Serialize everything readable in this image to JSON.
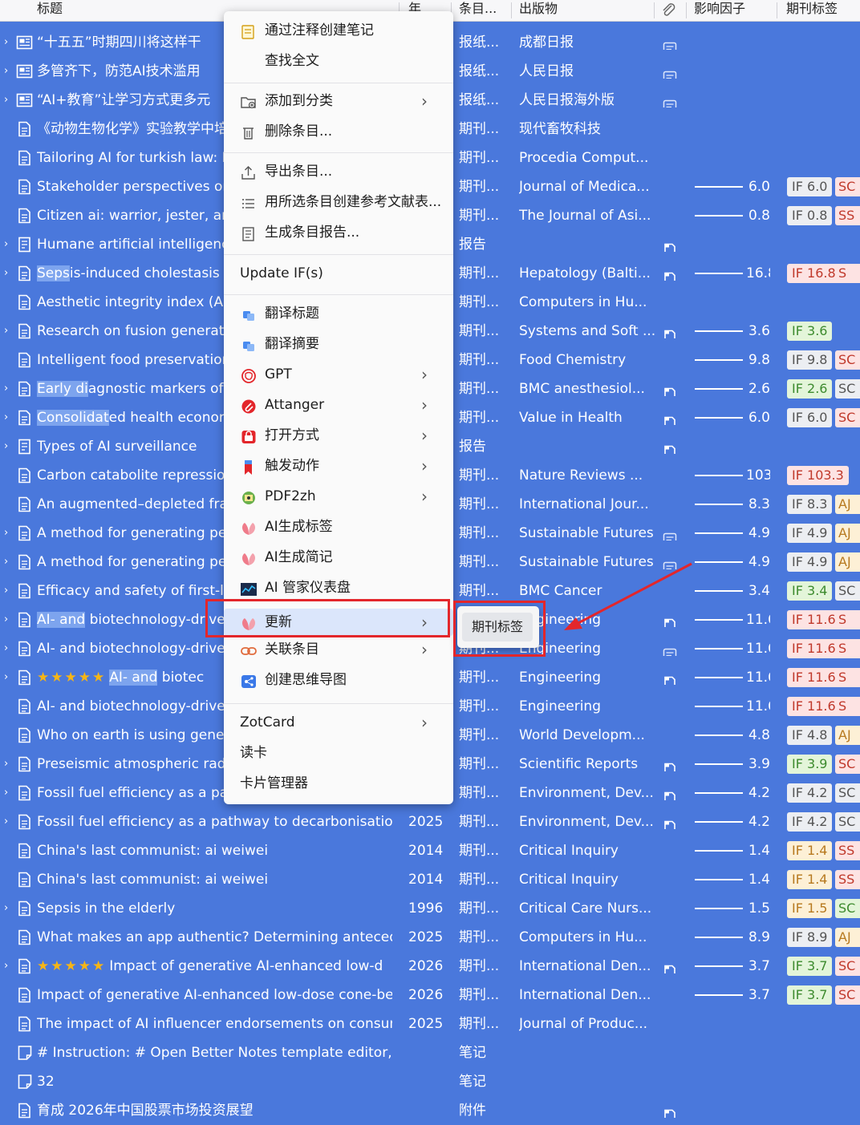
{
  "columns": [
    "标题",
    "年",
    "条目...",
    "出版物",
    "影响因子",
    "期刊标签"
  ],
  "colors": {
    "row_bg": "#4a78dc",
    "if_tag_bg": "#eceef2",
    "accent_red": "#e3262b"
  },
  "rows": [
    {
      "twisty": "›",
      "icon": "news-icon",
      "title": "“十五五”时期四川将这样干",
      "year": "",
      "type": "报纸...",
      "pub": "成都日报",
      "att": "link-icon"
    },
    {
      "twisty": "›",
      "icon": "news-icon",
      "title": "多管齐下，防范AI技术滥用",
      "year": "",
      "type": "报纸...",
      "pub": "人民日报",
      "att": "link-icon"
    },
    {
      "twisty": "›",
      "icon": "news-icon",
      "title": "“AI+教育”让学习方式更多元",
      "year": "",
      "type": "报纸...",
      "pub": "人民日报海外版",
      "att": "link-icon"
    },
    {
      "twisty": "",
      "icon": "doc-icon",
      "title": "《动物生物化学》实验教学中培",
      "year": "",
      "type": "期刊...",
      "pub": "现代畜牧科技"
    },
    {
      "twisty": "",
      "icon": "doc-icon",
      "title": "Tailoring AI for turkish law: D",
      "year": "",
      "type": "期刊...",
      "pub": "Procedia Comput..."
    },
    {
      "twisty": "",
      "icon": "doc-icon",
      "title": "Stakeholder perspectives on",
      "year": "",
      "type": "期刊...",
      "pub": "Journal of Medica...",
      "if": 6.0,
      "ifLabel": "6.0",
      "ifTag": "IF 6.0",
      "ifBg": "#eceef2",
      "ifColor": "#555",
      "tag": "SC",
      "tagBg": "#fde3e3",
      "tagColor": "#c0392b"
    },
    {
      "twisty": "",
      "icon": "doc-icon",
      "title": "Citizen ai: warrior, jester, and",
      "year": "",
      "type": "期刊...",
      "pub": "The Journal of Asi...",
      "if": 0.8,
      "ifLabel": "0.8",
      "ifTag": "IF 0.8",
      "ifBg": "#eceef2",
      "ifColor": "#555",
      "tag": "SS",
      "tagBg": "#fde3e3",
      "tagColor": "#c0392b"
    },
    {
      "twisty": "›",
      "icon": "report-icon",
      "title": "Humane artificial intelligence",
      "year": "",
      "type": "报告",
      "pub": "",
      "att": "pdf-icon"
    },
    {
      "twisty": "›",
      "icon": "doc-icon",
      "title": "Sepsis-induced cholestasis",
      "titleHl": "Seps",
      "year": "",
      "type": "期刊...",
      "pub": "Hepatology (Balti...",
      "att": "pdf-icon",
      "if": 16.8,
      "ifLabel": "16.8",
      "ifTag": "IF 16.8",
      "ifBg": "#fde3e3",
      "ifColor": "#c0392b",
      "tag": "S",
      "tagBg": "#fde3e3",
      "tagColor": "#c0392b"
    },
    {
      "twisty": "",
      "icon": "doc-icon",
      "title": "Aesthetic integrity index (AII)",
      "year": "",
      "type": "期刊...",
      "pub": "Computers in Hu..."
    },
    {
      "twisty": "›",
      "icon": "doc-icon",
      "title": "Research on fusion generatio",
      "year": "",
      "type": "期刊...",
      "pub": "Systems and Soft ...",
      "att": "pdf-icon",
      "if": 3.6,
      "ifLabel": "3.6",
      "ifTag": "IF 3.6",
      "ifBg": "#e3f5d9",
      "ifColor": "#3d8b2e",
      "tag": "",
      "tagBg": "",
      "tagColor": ""
    },
    {
      "twisty": "",
      "icon": "doc-icon",
      "title": "Intelligent food preservation",
      "year": "",
      "type": "期刊...",
      "pub": "Food Chemistry",
      "if": 9.8,
      "ifLabel": "9.8",
      "ifTag": "IF 9.8",
      "ifBg": "#eceef2",
      "ifColor": "#555",
      "tag": "SC",
      "tagBg": "#fde3e3",
      "tagColor": "#c0392b"
    },
    {
      "twisty": "›",
      "icon": "doc-icon",
      "title": "Early diagnostic markers of s",
      "titleHl": "Early di",
      "year": "",
      "type": "期刊...",
      "pub": "BMC anesthesiol...",
      "att": "pdf-icon",
      "if": 2.6,
      "ifLabel": "2.6",
      "ifTag": "IF 2.6",
      "ifBg": "#e3f5d9",
      "ifColor": "#3d8b2e",
      "tag": "SC",
      "tagBg": "#eceef2",
      "tagColor": "#555"
    },
    {
      "twisty": "›",
      "icon": "doc-icon",
      "title": "Consolidated health econom",
      "titleHl": "Consolidat",
      "year": "",
      "type": "期刊...",
      "pub": "Value in Health",
      "att": "pdf-icon",
      "if": 6.0,
      "ifLabel": "6.0",
      "ifTag": "IF 6.0",
      "ifBg": "#eceef2",
      "ifColor": "#555",
      "tag": "SC",
      "tagBg": "#fde3e3",
      "tagColor": "#c0392b"
    },
    {
      "twisty": "›",
      "icon": "report-icon",
      "title": "Types of AI surveillance",
      "year": "",
      "type": "报告",
      "pub": "",
      "att": "pdf-icon"
    },
    {
      "twisty": "",
      "icon": "doc-icon",
      "title": "Carbon catabolite repression",
      "year": "",
      "type": "期刊...",
      "pub": "Nature Reviews ...",
      "if": 103.3,
      "ifLabel": "103.3",
      "ifTag": "IF 103.3",
      "ifBg": "#fde3e3",
      "ifColor": "#c0392b",
      "tag": "",
      "tagBg": "",
      "tagColor": ""
    },
    {
      "twisty": "",
      "icon": "doc-icon",
      "title": "An augmented–depleted fran",
      "year": "",
      "type": "期刊...",
      "pub": "International Jour...",
      "if": 8.3,
      "ifLabel": "8.3",
      "ifTag": "IF 8.3",
      "ifBg": "#eceef2",
      "ifColor": "#555",
      "tag": "AJ",
      "tagBg": "#fdf0d6",
      "tagColor": "#b7791f"
    },
    {
      "twisty": "›",
      "icon": "doc-icon",
      "title": "A method for generating per",
      "year": "",
      "type": "期刊...",
      "pub": "Sustainable Futures",
      "att": "link-icon",
      "if": 4.9,
      "ifLabel": "4.9",
      "ifTag": "IF 4.9",
      "ifBg": "#eceef2",
      "ifColor": "#555",
      "tag": "AJ",
      "tagBg": "#fdf0d6",
      "tagColor": "#b7791f"
    },
    {
      "twisty": "›",
      "icon": "doc-icon",
      "title": "A method for generating per",
      "year": "",
      "type": "期刊...",
      "pub": "Sustainable Futures",
      "att": "link-icon",
      "if": 4.9,
      "ifLabel": "4.9",
      "ifTag": "IF 4.9",
      "ifBg": "#eceef2",
      "ifColor": "#555",
      "tag": "AJ",
      "tagBg": "#fdf0d6",
      "tagColor": "#b7791f"
    },
    {
      "twisty": "›",
      "icon": "doc-icon",
      "title": "Efficacy and safety of first-lin",
      "year": "",
      "type": "期刊...",
      "pub": "BMC Cancer",
      "if": 3.4,
      "ifLabel": "3.4",
      "ifTag": "IF 3.4",
      "ifBg": "#e3f5d9",
      "ifColor": "#3d8b2e",
      "tag": "SC",
      "tagBg": "#eceef2",
      "tagColor": "#555"
    },
    {
      "twisty": "›",
      "icon": "doc-icon",
      "title": "AI- and biotechnology-driven",
      "titleHl": "AI- and",
      "year": "",
      "type": "期刊...",
      "pub": "Engineering",
      "att": "pdf-icon",
      "if": 11.6,
      "ifLabel": "11.6",
      "ifTag": "IF 11.6",
      "ifBg": "#fde3e3",
      "ifColor": "#c0392b",
      "tag": "S",
      "tagBg": "#fde3e3",
      "tagColor": "#c0392b"
    },
    {
      "twisty": "›",
      "icon": "doc-icon",
      "title": "AI- and biotechnology-driven",
      "year": "",
      "type": "期刊...",
      "pub": "Engineering",
      "att": "link-icon",
      "if": 11.6,
      "ifLabel": "11.6",
      "ifTag": "IF 11.6",
      "ifBg": "#fde3e3",
      "ifColor": "#c0392b",
      "tag": "S",
      "tagBg": "#fde3e3",
      "tagColor": "#c0392b"
    },
    {
      "twisty": "›",
      "icon": "doc-icon",
      "stars": "★★★★★",
      "title": "AI- and biotec",
      "titleHl": "AI- and",
      "year": "",
      "type": "期刊...",
      "pub": "Engineering",
      "att": "pdf-icon",
      "if": 11.6,
      "ifLabel": "11.6",
      "ifTag": "IF 11.6",
      "ifBg": "#fde3e3",
      "ifColor": "#c0392b",
      "tag": "S",
      "tagBg": "#fde3e3",
      "tagColor": "#c0392b"
    },
    {
      "twisty": "",
      "icon": "doc-icon",
      "title": "AI- and biotechnology-driven",
      "year": "",
      "type": "期刊...",
      "pub": "Engineering",
      "if": 11.6,
      "ifLabel": "11.6",
      "ifTag": "IF 11.6",
      "ifBg": "#fde3e3",
      "ifColor": "#c0392b",
      "tag": "S",
      "tagBg": "#fde3e3",
      "tagColor": "#c0392b"
    },
    {
      "twisty": "",
      "icon": "doc-icon",
      "title": "Who on earth is using genera",
      "year": "",
      "type": "期刊...",
      "pub": "World Developm...",
      "if": 4.8,
      "ifLabel": "4.8",
      "ifTag": "IF 4.8",
      "ifBg": "#eceef2",
      "ifColor": "#555",
      "tag": "AJ",
      "tagBg": "#fdf0d6",
      "tagColor": "#b7791f"
    },
    {
      "twisty": "›",
      "icon": "doc-icon",
      "title": "Preseismic atmospheric rado",
      "year": "",
      "type": "期刊...",
      "pub": "Scientific Reports",
      "att": "pdf-icon",
      "if": 3.9,
      "ifLabel": "3.9",
      "ifTag": "IF 3.9",
      "ifBg": "#e3f5d9",
      "ifColor": "#3d8b2e",
      "tag": "SC",
      "tagBg": "#fde3e3",
      "tagColor": "#c0392b"
    },
    {
      "twisty": "›",
      "icon": "doc-icon",
      "title": "Fossil fuel efficiency as a path",
      "year": "",
      "type": "期刊...",
      "pub": "Environment, Dev...",
      "att": "pdf-icon",
      "if": 4.2,
      "ifLabel": "4.2",
      "ifTag": "IF 4.2",
      "ifBg": "#eceef2",
      "ifColor": "#555",
      "tag": "SC",
      "tagBg": "#eceef2",
      "tagColor": "#555"
    },
    {
      "twisty": "›",
      "icon": "doc-icon",
      "title": "Fossil fuel efficiency as a pathway to decarbonisation ar",
      "year": "2025",
      "type": "期刊...",
      "pub": "Environment, Dev...",
      "att": "pdf-icon",
      "if": 4.2,
      "ifLabel": "4.2",
      "ifTag": "IF 4.2",
      "ifBg": "#eceef2",
      "ifColor": "#555",
      "tag": "SC",
      "tagBg": "#eceef2",
      "tagColor": "#555"
    },
    {
      "twisty": "",
      "icon": "doc-icon",
      "title": "China's last communist: ai weiwei",
      "year": "2014",
      "type": "期刊...",
      "pub": "Critical Inquiry",
      "if": 1.4,
      "ifLabel": "1.4",
      "ifTag": "IF 1.4",
      "ifBg": "#fdf0d6",
      "ifColor": "#b7791f",
      "tag": "SS",
      "tagBg": "#fde3e3",
      "tagColor": "#c0392b"
    },
    {
      "twisty": "",
      "icon": "doc-icon",
      "title": "China's last communist: ai weiwei",
      "year": "2014",
      "type": "期刊...",
      "pub": "Critical Inquiry",
      "if": 1.4,
      "ifLabel": "1.4",
      "ifTag": "IF 1.4",
      "ifBg": "#fdf0d6",
      "ifColor": "#b7791f",
      "tag": "SS",
      "tagBg": "#fde3e3",
      "tagColor": "#c0392b"
    },
    {
      "twisty": "›",
      "icon": "doc-icon",
      "title": "Sepsis in the elderly",
      "year": "1996",
      "type": "期刊...",
      "pub": "Critical Care Nurs...",
      "if": 1.5,
      "ifLabel": "1.5",
      "ifTag": "IF 1.5",
      "ifBg": "#fdf0d6",
      "ifColor": "#b7791f",
      "tag": "SC",
      "tagBg": "#e3f5d9",
      "tagColor": "#3d8b2e"
    },
    {
      "twisty": "",
      "icon": "doc-icon",
      "title": "What makes an app authentic? Determining anteceden",
      "year": "2025",
      "type": "期刊...",
      "pub": "Computers in Hu...",
      "if": 8.9,
      "ifLabel": "8.9",
      "ifTag": "IF 8.9",
      "ifBg": "#eceef2",
      "ifColor": "#555",
      "tag": "AJ",
      "tagBg": "#fdf0d6",
      "tagColor": "#b7791f"
    },
    {
      "twisty": "›",
      "icon": "doc-icon",
      "stars": "★★★★★",
      "title": "Impact of generative AI-enhanced low-d",
      "year": "2026",
      "type": "期刊...",
      "pub": "International Den...",
      "att": "pdf-icon",
      "if": 3.7,
      "ifLabel": "3.7",
      "ifTag": "IF 3.7",
      "ifBg": "#e3f5d9",
      "ifColor": "#3d8b2e",
      "tag": "SC",
      "tagBg": "#fde3e3",
      "tagColor": "#c0392b"
    },
    {
      "twisty": "",
      "icon": "doc-icon",
      "title": "Impact of generative AI-enhanced low-dose cone-bean",
      "year": "2026",
      "type": "期刊...",
      "pub": "International Den...",
      "if": 3.7,
      "ifLabel": "3.7",
      "ifTag": "IF 3.7",
      "ifBg": "#e3f5d9",
      "ifColor": "#3d8b2e",
      "tag": "SC",
      "tagBg": "#fde3e3",
      "tagColor": "#c0392b"
    },
    {
      "twisty": "",
      "icon": "doc-icon",
      "title": "The impact of AI influencer endorsements on consumei",
      "year": "2025",
      "type": "期刊...",
      "pub": "Journal of Produc..."
    },
    {
      "twisty": "",
      "icon": "note-icon",
      "title": "# Instruction: # Open Better Notes template editor, clicl",
      "year": "",
      "type": "笔记",
      "pub": ""
    },
    {
      "twisty": "",
      "icon": "note-icon",
      "title": "32",
      "year": "",
      "type": "笔记",
      "pub": ""
    },
    {
      "twisty": "",
      "icon": "doc-icon",
      "title": "育成 2026年中国股票市场投资展望",
      "year": "",
      "type": "附件",
      "pub": "",
      "att": "pdf-icon"
    }
  ],
  "menu": {
    "items": [
      {
        "label": "通过注释创建笔记",
        "icon": "note-add-icon",
        "arrow": false
      },
      {
        "label": "查找全文",
        "icon": "",
        "arrow": false
      },
      {
        "sep": true
      },
      {
        "label": "添加到分类",
        "icon": "folder-add-icon",
        "arrow": true
      },
      {
        "label": "删除条目...",
        "icon": "trash-icon",
        "arrow": false
      },
      {
        "sep": true
      },
      {
        "label": "导出条目...",
        "icon": "export-icon",
        "arrow": false
      },
      {
        "label": "用所选条目创建参考文献表...",
        "icon": "bibliography-icon",
        "arrow": false
      },
      {
        "label": "生成条目报告...",
        "icon": "report-gen-icon",
        "arrow": false
      },
      {
        "sep": true
      },
      {
        "label": "Update IF(s)",
        "icon": "",
        "plain": true,
        "arrow": false
      },
      {
        "sep": true
      },
      {
        "label": "翻译标题",
        "icon": "translate-icon",
        "arrow": false
      },
      {
        "label": "翻译摘要",
        "icon": "translate-icon",
        "arrow": false
      },
      {
        "label": "GPT",
        "icon": "gpt-icon",
        "arrow": true
      },
      {
        "label": "Attanger",
        "icon": "attanger-icon",
        "arrow": true
      },
      {
        "label": "打开方式",
        "icon": "open-with-icon",
        "arrow": true
      },
      {
        "label": "触发动作",
        "icon": "bookmark-icon",
        "arrow": true
      },
      {
        "label": "PDF2zh",
        "icon": "pdf2zh-icon",
        "arrow": true
      },
      {
        "label": "AI生成标签",
        "icon": "ai-petal-icon",
        "arrow": false
      },
      {
        "label": "AI生成简记",
        "icon": "ai-petal-icon",
        "arrow": false
      },
      {
        "label": "AI 管家仪表盘",
        "icon": "dashboard-icon",
        "arrow": false
      },
      {
        "label": "更新",
        "icon": "ai-petal-icon",
        "arrow": true,
        "hover": true
      },
      {
        "label": "关联条目",
        "icon": "link-chain-icon",
        "arrow": true
      },
      {
        "label": "创建思维导图",
        "icon": "mindmap-icon",
        "arrow": false
      },
      {
        "sep": true
      },
      {
        "label": "ZotCard",
        "icon": "",
        "plain": true,
        "arrow": true
      },
      {
        "label": "读卡",
        "icon": "",
        "plain": true,
        "arrow": false
      },
      {
        "label": "卡片管理器",
        "icon": "",
        "plain": true,
        "arrow": false
      }
    ]
  },
  "submenu": {
    "item": "期刊标签"
  }
}
